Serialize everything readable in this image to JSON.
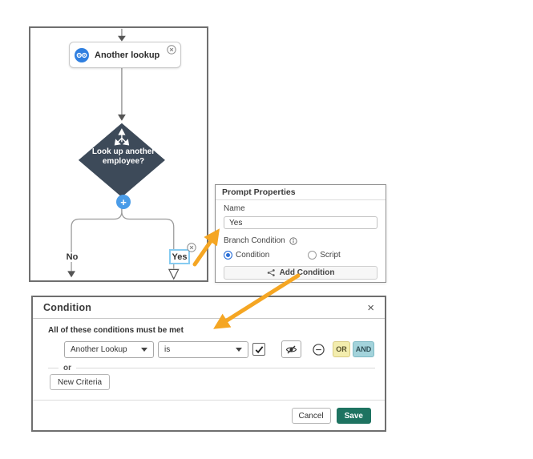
{
  "flowchart": {
    "node_label": "Another lookup",
    "diamond_label": "Look up another\nemployee?",
    "plus_glyph": "+",
    "no_label": "No",
    "yes_label": "Yes"
  },
  "prompt_properties": {
    "title": "Prompt Properties",
    "name_label": "Name",
    "name_value": "Yes",
    "branch_condition_label": "Branch Condition",
    "option_condition": "Condition",
    "option_script": "Script",
    "add_condition_label": "Add Condition",
    "selected_option": "Condition"
  },
  "condition_dialog": {
    "title": "Condition",
    "close_glyph": "×",
    "note": "All of these conditions must be met",
    "field_dropdown_value": "Another Lookup",
    "operator_dropdown_value": "is",
    "checkbox_checked": true,
    "or_label": "OR",
    "and_label": "AND",
    "or_divider": "or",
    "new_criteria_label": "New Criteria",
    "cancel_label": "Cancel",
    "save_label": "Save"
  },
  "colors": {
    "accent_blue": "#2f7fe0",
    "diamond_fill": "#3d4a59",
    "arrow_orange": "#f5a623",
    "or_button_bg": "#f3edae",
    "and_button_bg": "#a3d3db",
    "save_button_bg": "#1e7361",
    "yes_selection_border": "#86cbf1"
  }
}
